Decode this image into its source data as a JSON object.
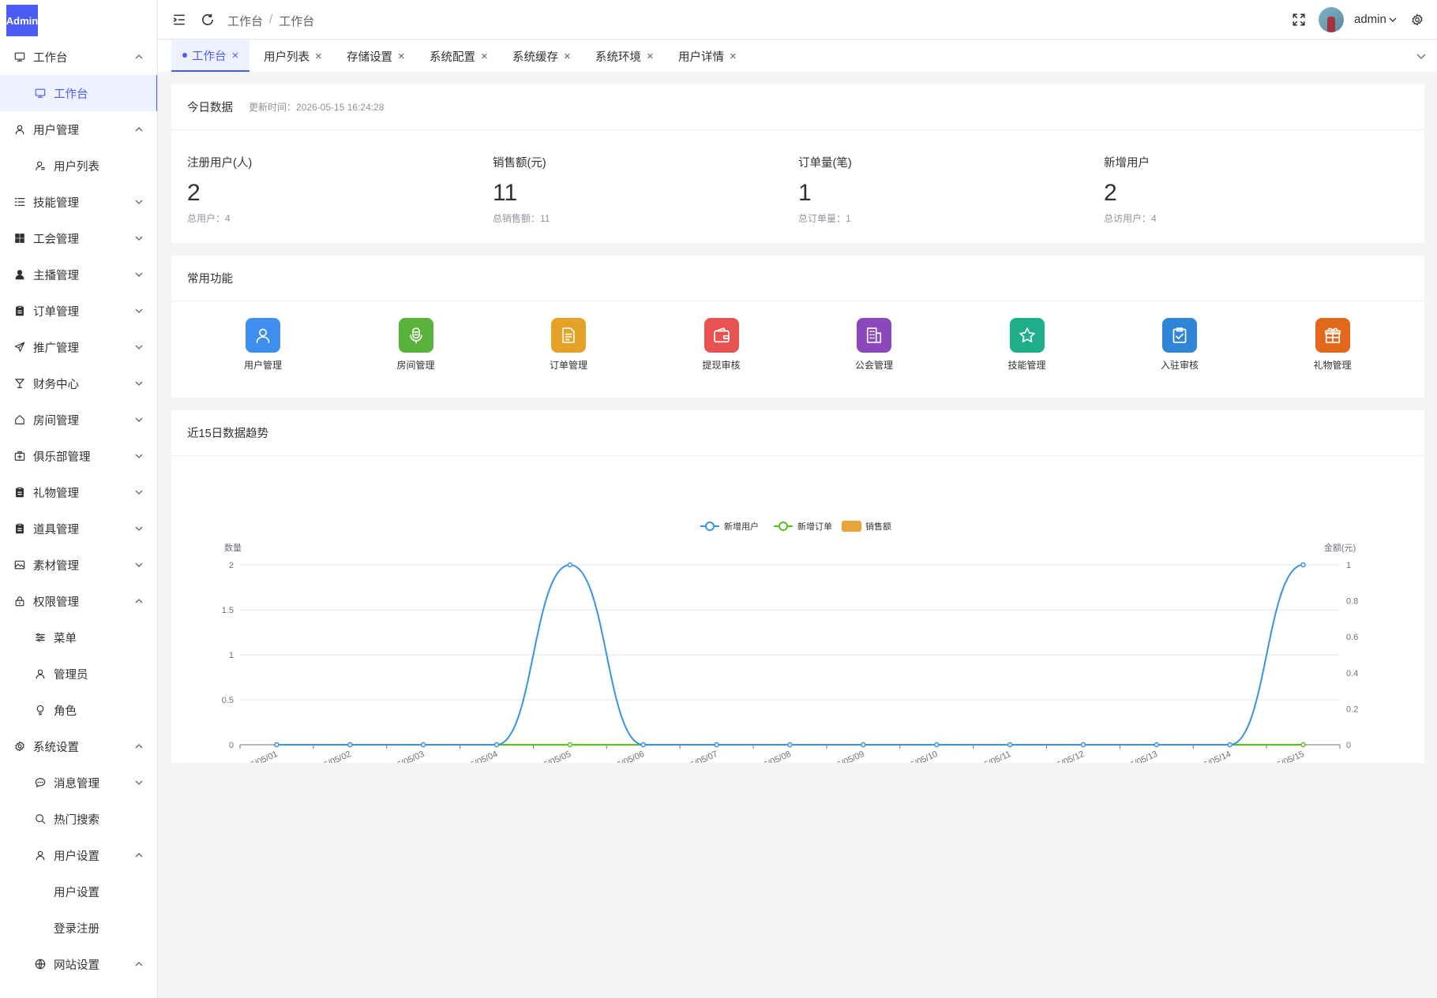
{
  "logo": "Admin",
  "sidebar": {
    "items": [
      {
        "label": "工作台",
        "icon": "monitor-icon",
        "level": 0,
        "arrow": "up"
      },
      {
        "label": "工作台",
        "icon": "monitor-icon",
        "level": 1,
        "active": true
      },
      {
        "label": "用户管理",
        "icon": "user-icon",
        "level": 0,
        "arrow": "up"
      },
      {
        "label": "用户列表",
        "icon": "user-list-icon",
        "level": 1
      },
      {
        "label": "技能管理",
        "icon": "list-icon",
        "level": 0,
        "arrow": "down"
      },
      {
        "label": "工会管理",
        "icon": "grid-icon",
        "level": 0,
        "arrow": "down"
      },
      {
        "label": "主播管理",
        "icon": "person-filled-icon",
        "level": 0,
        "arrow": "down"
      },
      {
        "label": "订单管理",
        "icon": "clipboard-icon",
        "level": 0,
        "arrow": "down"
      },
      {
        "label": "推广管理",
        "icon": "send-icon",
        "level": 0,
        "arrow": "down"
      },
      {
        "label": "财务中心",
        "icon": "goblet-icon",
        "level": 0,
        "arrow": "down"
      },
      {
        "label": "房间管理",
        "icon": "house-icon",
        "level": 0,
        "arrow": "down"
      },
      {
        "label": "俱乐部管理",
        "icon": "first-aid-kit-icon",
        "level": 0,
        "arrow": "down"
      },
      {
        "label": "礼物管理",
        "icon": "clipboard-icon",
        "level": 0,
        "arrow": "down"
      },
      {
        "label": "道具管理",
        "icon": "clipboard-icon",
        "level": 0,
        "arrow": "down"
      },
      {
        "label": "素材管理",
        "icon": "picture-icon",
        "level": 0,
        "arrow": "down"
      },
      {
        "label": "权限管理",
        "icon": "lock-icon",
        "level": 0,
        "arrow": "up"
      },
      {
        "label": "菜单",
        "icon": "sliders-icon",
        "level": 1
      },
      {
        "label": "管理员",
        "icon": "user-icon",
        "level": 1
      },
      {
        "label": "角色",
        "icon": "bulb-icon",
        "level": 1
      },
      {
        "label": "系统设置",
        "icon": "gear-icon",
        "level": 0,
        "arrow": "up"
      },
      {
        "label": "消息管理",
        "icon": "chat-icon",
        "level": 1,
        "arrow": "down"
      },
      {
        "label": "热门搜索",
        "icon": "search-icon",
        "level": 1
      },
      {
        "label": "用户设置",
        "icon": "user-icon",
        "level": 1,
        "arrow": "up"
      },
      {
        "label": "用户设置",
        "icon": "",
        "level": 2
      },
      {
        "label": "登录注册",
        "icon": "",
        "level": 2
      },
      {
        "label": "网站设置",
        "icon": "globe-icon",
        "level": 1,
        "arrow": "up"
      }
    ]
  },
  "header": {
    "breadcrumb": [
      "工作台",
      "工作台"
    ],
    "breadcrumb_sep": "/",
    "username": "admin"
  },
  "tabs": [
    {
      "label": "工作台",
      "active": true
    },
    {
      "label": "用户列表"
    },
    {
      "label": "存储设置"
    },
    {
      "label": "系统配置"
    },
    {
      "label": "系统缓存"
    },
    {
      "label": "系统环境"
    },
    {
      "label": "用户详情"
    }
  ],
  "tab_close": "×",
  "today": {
    "title": "今日数据",
    "updated_label": "更新时间：",
    "updated_time": "2026-05-15 16:24:28",
    "stats": [
      {
        "label": "注册用户(人)",
        "value": "2",
        "sub_label": "总用户：",
        "sub_value": "4"
      },
      {
        "label": "销售额(元)",
        "value": "11",
        "sub_label": "总销售额：",
        "sub_value": "11"
      },
      {
        "label": "订单量(笔)",
        "value": "1",
        "sub_label": "总订单量：",
        "sub_value": "1"
      },
      {
        "label": "新增用户",
        "value": "2",
        "sub_label": "总访用户：",
        "sub_value": "4"
      }
    ]
  },
  "common": {
    "title": "常用功能",
    "items": [
      {
        "label": "用户管理",
        "icon": "user-icon",
        "color": "#3f8ff0"
      },
      {
        "label": "房间管理",
        "icon": "microphone-icon",
        "color": "#59b23a"
      },
      {
        "label": "订单管理",
        "icon": "document-icon",
        "color": "#e4a226"
      },
      {
        "label": "提现审核",
        "icon": "wallet-icon",
        "color": "#e85252"
      },
      {
        "label": "公会管理",
        "icon": "building-icon",
        "color": "#8c47bd"
      },
      {
        "label": "技能管理",
        "icon": "star-icon",
        "color": "#1fae8a"
      },
      {
        "label": "入驻审核",
        "icon": "clipboard-check-icon",
        "color": "#2f86d6"
      },
      {
        "label": "礼物管理",
        "icon": "gift-icon",
        "color": "#e2681c"
      }
    ]
  },
  "trend": {
    "title": "近15日数据趋势"
  },
  "chart_data": {
    "type": "line",
    "x": [
      "2026/05/01",
      "2026/05/02",
      "2026/05/03",
      "2026/05/04",
      "2026/05/05",
      "2026/05/06",
      "2026/05/07",
      "2026/05/08",
      "2026/05/09",
      "2026/05/10",
      "2026/05/11",
      "2026/05/12",
      "2026/05/13",
      "2026/05/14",
      "2026/05/15"
    ],
    "series": [
      {
        "name": "新增用户",
        "type": "line",
        "axis": "left",
        "color": "#3a92e8",
        "values": [
          0,
          0,
          0,
          0,
          2,
          0,
          0,
          0,
          0,
          0,
          0,
          0,
          0,
          0,
          2
        ]
      },
      {
        "name": "新增订单",
        "type": "line",
        "axis": "left",
        "color": "#52c41a",
        "values": [
          0,
          0,
          0,
          0,
          0,
          0,
          0,
          0,
          0,
          0,
          0,
          0,
          0,
          0,
          0
        ]
      },
      {
        "name": "销售额",
        "type": "bar",
        "axis": "right",
        "color": "#e8a33b",
        "values": [
          0,
          0,
          0,
          0,
          0,
          0,
          0,
          0,
          0,
          0,
          0,
          0,
          0,
          0,
          0
        ]
      }
    ],
    "ylabel_left": "数量",
    "ylabel_right": "金额(元)",
    "yticks_left": [
      "0",
      "0.5",
      "1",
      "1.5",
      "2"
    ],
    "yticks_right": [
      "0",
      "0.2",
      "0.4",
      "0.6",
      "0.8",
      "1"
    ],
    "ylim_left": [
      0,
      2
    ],
    "ylim_right": [
      0,
      1
    ],
    "legend": "top-center",
    "grid": true,
    "smooth": true
  }
}
